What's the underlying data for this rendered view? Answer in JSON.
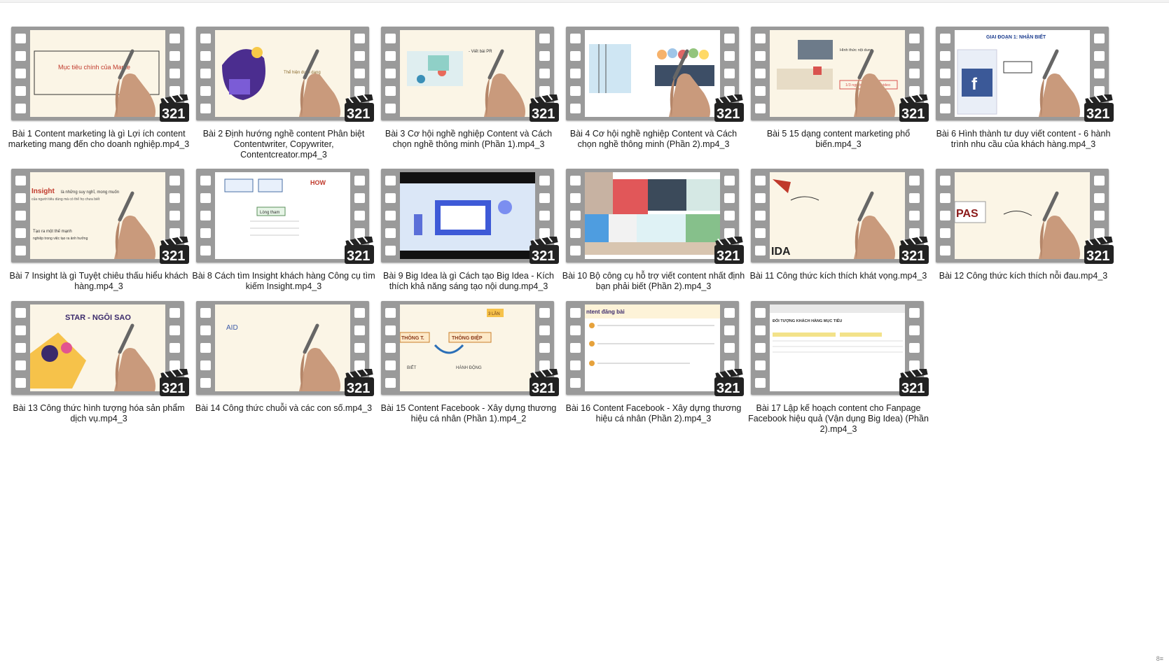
{
  "window": {
    "view": "large-icons"
  },
  "colors": {
    "film": "#9a9a9a",
    "screen": "#fbf5e6",
    "badge_orange": "#f26522"
  },
  "files": [
    {
      "name": "Bài 1 Content marketing là gì Lợi ích content marketing mang đến cho doanh nghiệp.mp4_3",
      "thumb_text": "Mục tiêu chính của Marke",
      "theme": "hand-text"
    },
    {
      "name": "Bài 2 Định hướng nghề content Phân biệt Contentwriter, Copywriter, Contentcreator.mp4_3",
      "thumb_text": "Thể hiện dưới dạng",
      "theme": "creator"
    },
    {
      "name": "Bài 3 Cơ hội nghề nghiệp Content và Cách chọn nghề thông minh (Phần 1).mp4_3",
      "thumb_text": "- Viết bài PR",
      "theme": "office"
    },
    {
      "name": "Bài 4 Cơ hội nghề nghiệp Content và Cách chọn nghề thông minh (Phần 2).mp4_3",
      "thumb_text": "",
      "theme": "people"
    },
    {
      "name": "Bài 5 15 dạng content marketing phổ biến.mp4_3",
      "thumb_text": "1/3 người dùng xem video",
      "theme": "desk"
    },
    {
      "name": "Bài 6 Hình thành tư duy viết content - 6 hành trình nhu cầu của khách hàng.mp4_3",
      "thumb_text": "GIAI ĐOẠN 1: NHẬN BIẾT",
      "theme": "facebook"
    },
    {
      "name": "Bài 7 Insight là gì Tuyệt chiêu thấu hiểu khách hàng.mp4_3",
      "thumb_text": "Insight",
      "theme": "insight"
    },
    {
      "name": "Bài 8 Cách tìm Insight khách hàng Công cụ tìm kiếm Insight.mp4_3",
      "thumb_text": "HOW",
      "theme": "mindmap"
    },
    {
      "name": "Bài 9 Big Idea là gì Cách tạo Big Idea - Kích thích khả năng sáng tạo nội dung.mp4_3",
      "thumb_text": "",
      "theme": "bigidea"
    },
    {
      "name": "Bài 10 Bộ công cụ hỗ trợ viết content nhất định bạn phải biết (Phần 2).mp4_3",
      "thumb_text": "",
      "theme": "collage"
    },
    {
      "name": "Bài 11 Công thức kích thích khát vọng.mp4_3",
      "thumb_text": "IDA",
      "theme": "ida"
    },
    {
      "name": "Bài 12 Công thức kích thích nỗi đau.mp4_3",
      "thumb_text": "PAS",
      "theme": "pas"
    },
    {
      "name": "Bài 13 Công thức hình tượng hóa sản phẩm dịch vụ.mp4_3",
      "thumb_text": "STAR - NGÔI SAO",
      "theme": "star"
    },
    {
      "name": "Bài 14 Công thức chuỗi và các con số.mp4_3",
      "thumb_text": "AID",
      "theme": "aid"
    },
    {
      "name": "Bài 15 Content Facebook - Xây dựng thương hiệu cá nhân (Phần 1).mp4_2",
      "thumb_text": "THÔNG ĐIỆP",
      "theme": "flow"
    },
    {
      "name": "Bài 16 Content Facebook - Xây dựng thương hiệu cá nhân (Phần 2).mp4_3",
      "thumb_text": "ntent đăng bài",
      "theme": "doc"
    },
    {
      "name": "Bài 17 Lập kế hoạch content cho Fanpage Facebook hiệu quả (Vận dụng Big Idea) (Phần 2).mp4_3",
      "thumb_text": "ĐỐI TƯỢNG KHÁCH HÀNG MỤC TIÊU",
      "theme": "sheet"
    }
  ],
  "badge_text": "321",
  "corner_text": "8≡"
}
